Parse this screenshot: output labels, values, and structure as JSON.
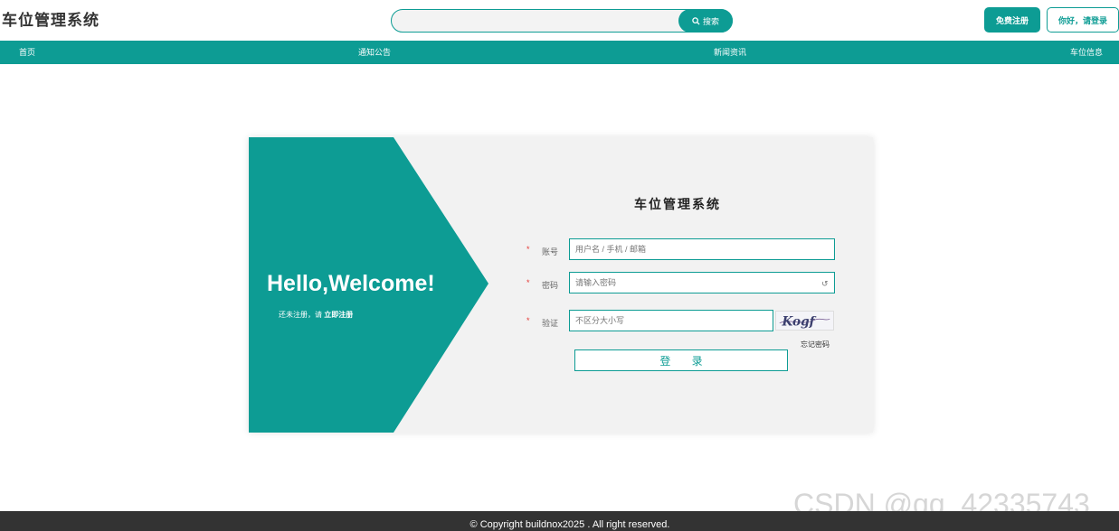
{
  "header": {
    "brand": "车位管理系统",
    "search": {
      "placeholder": "",
      "button_label": "搜索"
    },
    "register_label": "免费注册",
    "login_label": "你好，请登录"
  },
  "nav": {
    "items": [
      {
        "label": "首页"
      },
      {
        "label": "通知公告"
      },
      {
        "label": "新闻资讯"
      },
      {
        "label": "车位信息"
      }
    ]
  },
  "welcome": {
    "greeting": "Hello,Welcome!",
    "no_account_text": "还未注册，请 ",
    "register_link": "立即注册"
  },
  "login_form": {
    "title": "车位管理系统",
    "account": {
      "label": "账号",
      "placeholder": "用户名 / 手机 / 邮箱"
    },
    "password": {
      "label": "密码",
      "placeholder": "请输入密码"
    },
    "captcha": {
      "label": "验证",
      "placeholder": "不区分大小写",
      "code": "Kogf"
    },
    "forgot_label": "忘记密码",
    "submit_label": "登 录",
    "required_mark": "*"
  },
  "footer": {
    "copyright": "© Copyright buildnox2025 . All right reserved."
  },
  "watermark": "CSDN @qq_42335743",
  "colors": {
    "accent": "#0d9c94",
    "panel_bg": "#f2f2f2",
    "footer_bg": "#333333"
  },
  "icons": {
    "search": "search-icon",
    "eye": "eye-toggle-icon"
  }
}
